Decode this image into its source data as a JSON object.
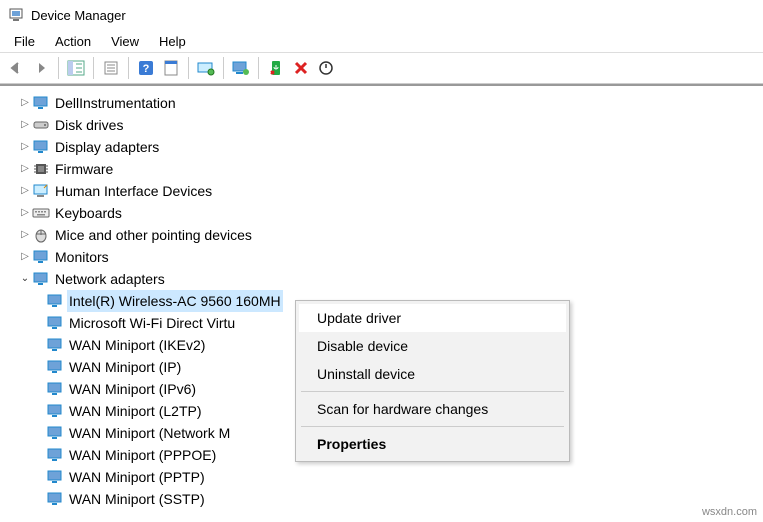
{
  "window": {
    "title": "Device Manager"
  },
  "menu": {
    "file": "File",
    "action": "Action",
    "view": "View",
    "help": "Help"
  },
  "tree": {
    "categories": [
      {
        "label": "DellInstrumentation",
        "icon": "monitor"
      },
      {
        "label": "Disk drives",
        "icon": "disk"
      },
      {
        "label": "Display adapters",
        "icon": "monitor"
      },
      {
        "label": "Firmware",
        "icon": "firmware"
      },
      {
        "label": "Human Interface Devices",
        "icon": "hid"
      },
      {
        "label": "Keyboards",
        "icon": "keyboard"
      },
      {
        "label": "Mice and other pointing devices",
        "icon": "mouse"
      },
      {
        "label": "Monitors",
        "icon": "monitor"
      },
      {
        "label": "Network adapters",
        "icon": "monitor",
        "expanded": true
      }
    ],
    "network_children": [
      {
        "label": "Intel(R) Wireless-AC 9560 160MH",
        "selected": true
      },
      {
        "label": "Microsoft Wi-Fi Direct Virtu"
      },
      {
        "label": "WAN Miniport (IKEv2)"
      },
      {
        "label": "WAN Miniport (IP)"
      },
      {
        "label": "WAN Miniport (IPv6)"
      },
      {
        "label": "WAN Miniport (L2TP)"
      },
      {
        "label": "WAN Miniport (Network M"
      },
      {
        "label": "WAN Miniport (PPPOE)"
      },
      {
        "label": "WAN Miniport (PPTP)"
      },
      {
        "label": "WAN Miniport (SSTP)"
      }
    ]
  },
  "context_menu": {
    "update": "Update driver",
    "disable": "Disable device",
    "uninstall": "Uninstall device",
    "scan": "Scan for hardware changes",
    "properties": "Properties"
  },
  "watermark": "wsxdn.com"
}
